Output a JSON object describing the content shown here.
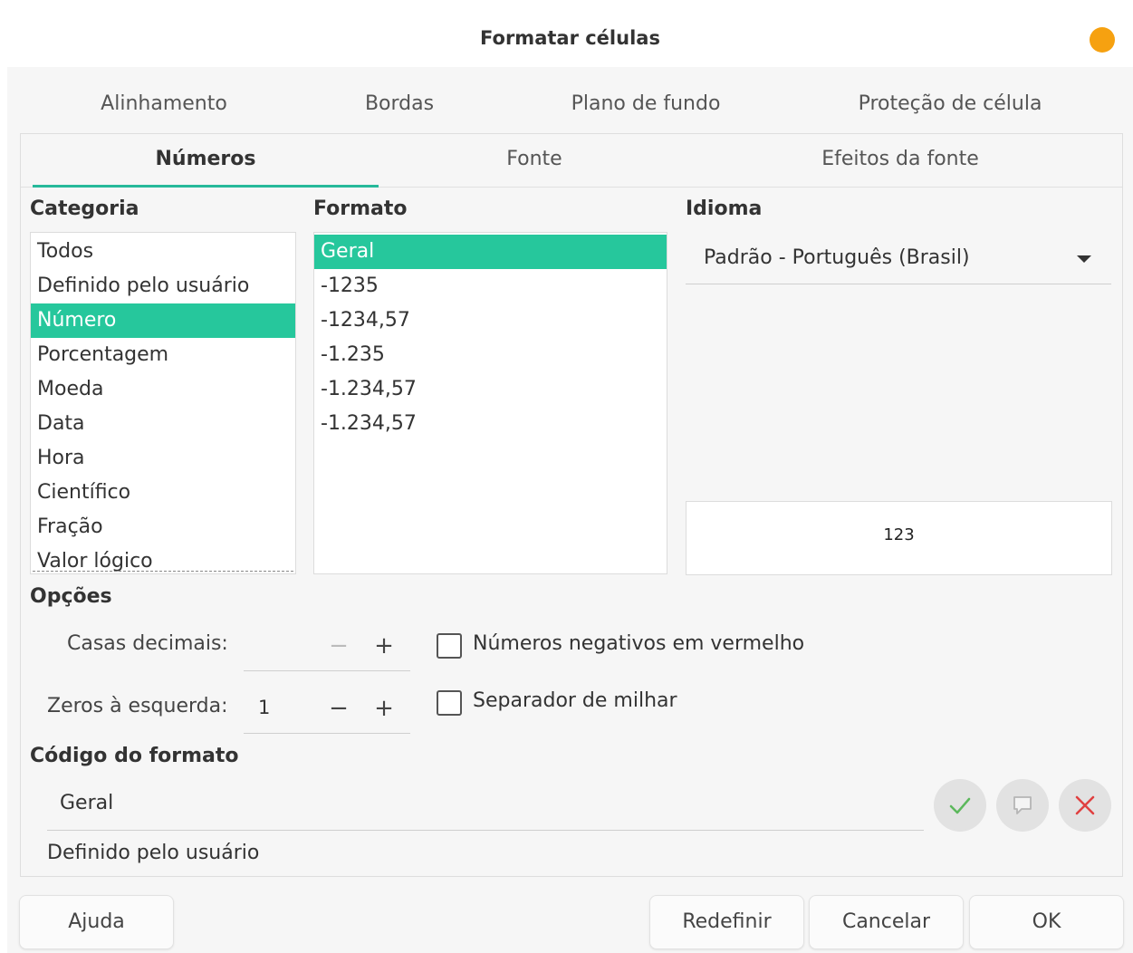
{
  "window": {
    "title": "Formatar células"
  },
  "tabs_row1": [
    "Alinhamento",
    "Bordas",
    "Plano de fundo",
    "Proteção de célula"
  ],
  "tabs_row2": [
    "Números",
    "Fonte",
    "Efeitos da fonte"
  ],
  "active_tab": "Números",
  "category": {
    "label": "Categoria",
    "items": [
      "Todos",
      "Definido pelo usuário",
      "Número",
      "Porcentagem",
      "Moeda",
      "Data",
      "Hora",
      "Científico",
      "Fração",
      "Valor lógico"
    ],
    "selected": "Número"
  },
  "format": {
    "label": "Formato",
    "items": [
      "Geral",
      "-1235",
      "-1234,57",
      "-1.235",
      "-1.234,57",
      "-1.234,57"
    ],
    "selected": "Geral"
  },
  "language": {
    "label": "Idioma",
    "value": "Padrão - Português (Brasil)"
  },
  "preview": {
    "text": "123"
  },
  "options": {
    "label": "Opções",
    "decimal_places": {
      "label": "Casas decimais:",
      "value": ""
    },
    "leading_zeros": {
      "label": "Zeros à esquerda:",
      "value": "1"
    },
    "negative_red": {
      "label": "Números negativos em vermelho",
      "checked": false
    },
    "thousands_sep": {
      "label": "Separador de milhar",
      "checked": false
    }
  },
  "format_code": {
    "label": "Código do formato",
    "value": "Geral",
    "description": "Definido pelo usuário"
  },
  "buttons": {
    "help": "Ajuda",
    "reset": "Redefinir",
    "cancel": "Cancelar",
    "ok": "OK"
  },
  "icons": {
    "add": "check-icon",
    "comment": "comment-icon",
    "delete": "delete-icon",
    "spin_minus": "−",
    "spin_plus": "+"
  },
  "colors": {
    "accent": "#26c79c",
    "close": "#f6a110",
    "delete": "#e04040",
    "check": "#4caf50"
  }
}
